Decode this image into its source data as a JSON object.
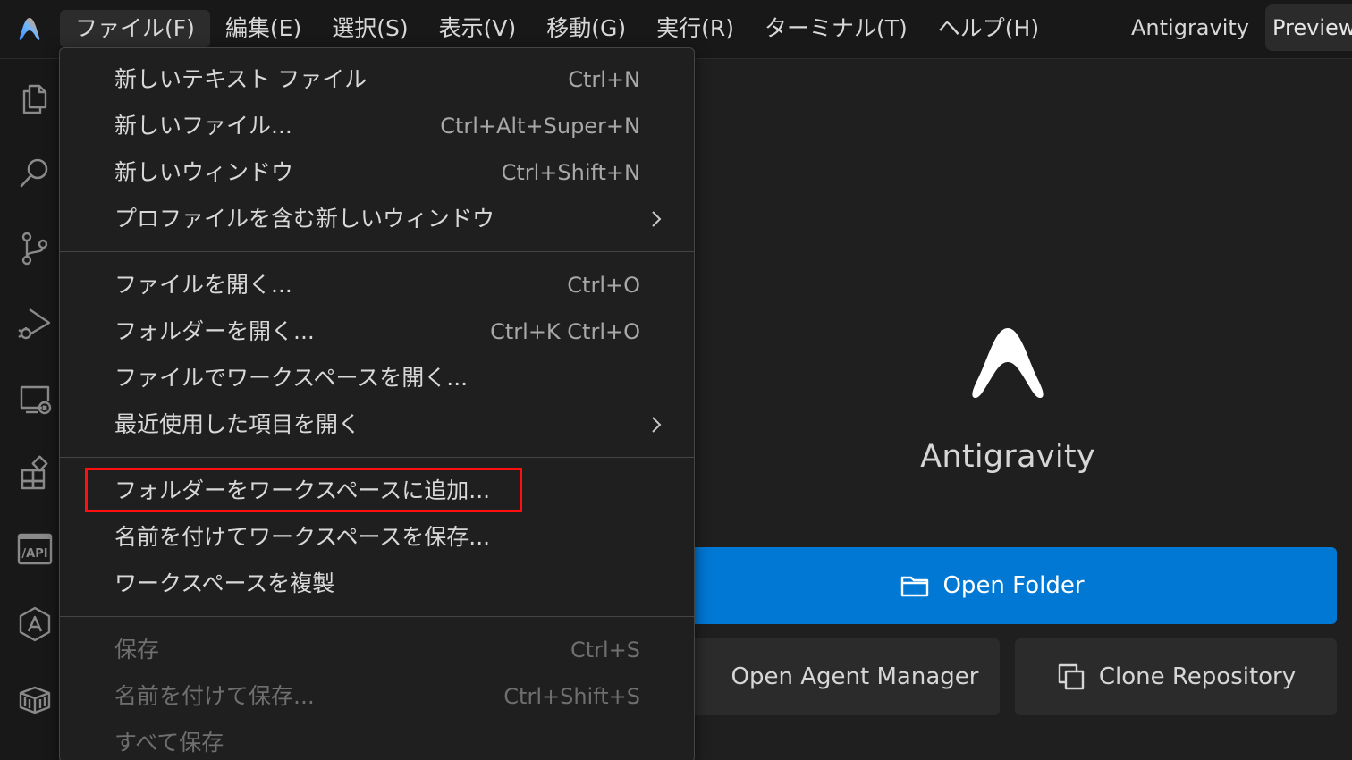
{
  "titlebar": {
    "menus": [
      {
        "label": "ファイル(F)",
        "active": true
      },
      {
        "label": "編集(E)"
      },
      {
        "label": "選択(S)"
      },
      {
        "label": "表示(V)"
      },
      {
        "label": "移動(G)"
      },
      {
        "label": "実行(R)"
      },
      {
        "label": "ターミナル(T)"
      },
      {
        "label": "ヘルプ(H)"
      }
    ],
    "app_name": "Antigravity",
    "badge": "Preview"
  },
  "activitybar": {
    "icons": [
      "explorer-icon",
      "search-icon",
      "source-control-icon",
      "run-debug-icon",
      "remote-explorer-icon",
      "extensions-icon",
      "api-icon",
      "agent-icon",
      "package-icon"
    ]
  },
  "welcome": {
    "title": "Antigravity",
    "open_folder": "Open Folder",
    "open_agent_manager": "Open Agent Manager",
    "clone_repository": "Clone Repository",
    "primary_color": "#0078d4"
  },
  "file_menu": {
    "items": [
      {
        "label": "新しいテキスト ファイル",
        "shortcut": "Ctrl+N"
      },
      {
        "label": "新しいファイル...",
        "shortcut": "Ctrl+Alt+Super+N"
      },
      {
        "label": "新しいウィンドウ",
        "shortcut": "Ctrl+Shift+N"
      },
      {
        "label": "プロファイルを含む新しいウィンドウ",
        "shortcut": "",
        "submenu": true
      },
      {
        "label": "ファイルを開く...",
        "shortcut": "Ctrl+O"
      },
      {
        "label": "フォルダーを開く...",
        "shortcut": "Ctrl+K Ctrl+O"
      },
      {
        "label": "ファイルでワークスペースを開く...",
        "shortcut": ""
      },
      {
        "label": "最近使用した項目を開く",
        "shortcut": "",
        "submenu": true
      },
      {
        "label": "フォルダーをワークスペースに追加...",
        "shortcut": "",
        "highlighted": true
      },
      {
        "label": "名前を付けてワークスペースを保存...",
        "shortcut": ""
      },
      {
        "label": "ワークスペースを複製",
        "shortcut": ""
      },
      {
        "label": "保存",
        "shortcut": "Ctrl+S",
        "disabled": true
      },
      {
        "label": "名前を付けて保存...",
        "shortcut": "Ctrl+Shift+S",
        "disabled": true
      },
      {
        "label": "すべて保存",
        "shortcut": "",
        "disabled": true
      }
    ],
    "highlight_color": "#ff1010"
  }
}
